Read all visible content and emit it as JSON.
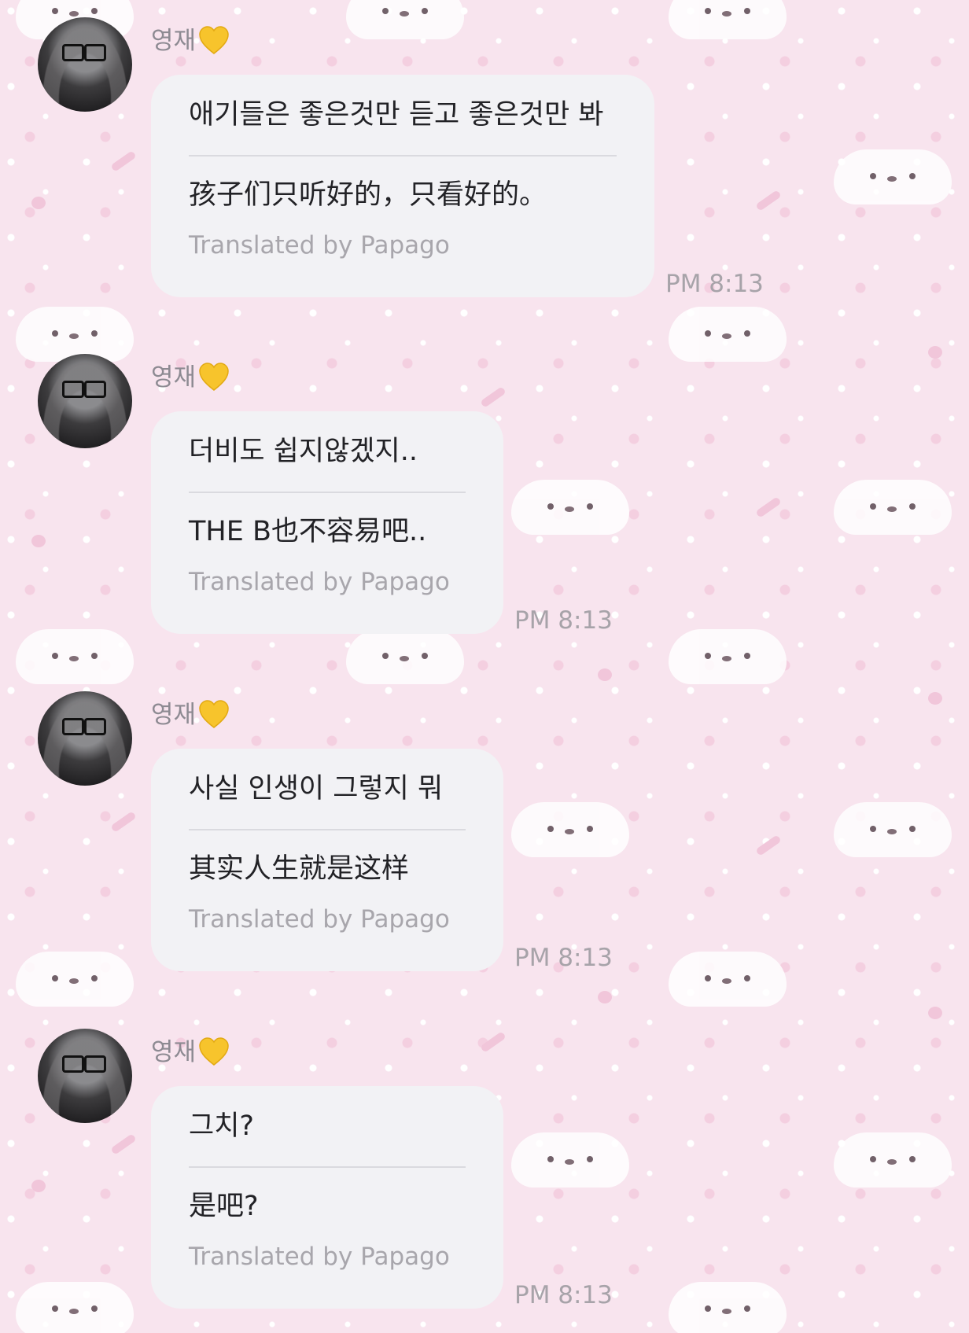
{
  "messages": [
    {
      "sender": "영재",
      "original": "애기들은 좋은것만 듣고 좋은것만 봐",
      "translation": "孩子们只听好的，只看好的。",
      "credit": "Translated by Papago",
      "time": "PM 8:13"
    },
    {
      "sender": "영재",
      "original": "더비도 쉽지않겠지..",
      "translation": "THE B也不容易吧..",
      "credit": "Translated by Papago",
      "time": "PM 8:13"
    },
    {
      "sender": "영재",
      "original": "사실 인생이 그렇지 뭐",
      "translation": "其实人生就是这样",
      "credit": "Translated by Papago",
      "time": "PM 8:13"
    },
    {
      "sender": "영재",
      "original": "그치?",
      "translation": "是吧?",
      "credit": "Translated by Papago",
      "time": "PM 8:13"
    }
  ],
  "colors": {
    "background": "#f8e4ee",
    "bubble": "#f2f2f5",
    "heart": "#f7c42c"
  },
  "icons": {
    "sender_badge": "yellow-heart-icon",
    "avatar": "avatar"
  }
}
